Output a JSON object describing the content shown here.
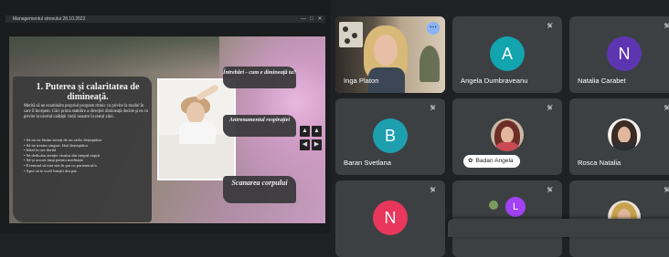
{
  "share": {
    "window_title": "Managementul stresului 28.10.2022",
    "window_buttons": {
      "minimize": "—",
      "maximize": "□",
      "close": "✕"
    },
    "slide": {
      "heading": "1. Puterea și calaritatea de dimineață.",
      "intro": "Merită să ne examinăm propriul program ritmic cu privire la modul în care îl începem. Căci prima stabilire a direcției dimineață decide și ea cu privire la nivelul calității vieții noastre în restul zilei.",
      "bullets": [
        "Să nu ne lăsăm treziți de un radio deșteptător",
        "Să ne trezim singuri, fără deșteptător",
        "Ideal la ora dorită",
        "Să dedicăm atenție visului din timpul nopții",
        "Să-și acorzi timp pentru meditație",
        "Eventual să mai stai în pat cu partenerul/a",
        "Apoi să te scoli liniștit din pat."
      ],
      "box1": "Întrebări - cum e dimineață ta?",
      "box2": "Antrenamentul respirației",
      "box3": "Scanarea corpului",
      "nav": [
        "▲",
        "▲",
        "◀",
        "▶"
      ]
    }
  },
  "participants": [
    {
      "name": "Inga Platon",
      "type": "video",
      "muted": false
    },
    {
      "name": "Angela Dumbraveanu",
      "initial": "A",
      "color": "#12a4af",
      "muted": true
    },
    {
      "name": "Natalia Carabet",
      "initial": "N",
      "color": "#5e35b1",
      "muted": true
    },
    {
      "name": "Baran Svetlana",
      "initial": "B",
      "color": "#1e9fb0",
      "muted": true
    },
    {
      "name": "Badan Angela",
      "type": "photo",
      "pinned_label": "Badan Angela",
      "muted": true
    },
    {
      "name": "Rosca Natalia",
      "type": "photo",
      "muted": true
    },
    {
      "name": "",
      "initial": "N",
      "color": "#e8375a",
      "muted": true
    },
    {
      "name": "",
      "initial": "L",
      "color": "#a142f4",
      "muted": true
    },
    {
      "name": "",
      "type": "photo",
      "muted": true
    }
  ],
  "icons": {
    "mute": "mic-off-icon",
    "more": "more-options-icon",
    "pin": "pin-icon"
  },
  "colors": {
    "background": "#202124",
    "tile": "#3c4043",
    "speaking_outline": "#8ab4f8"
  }
}
